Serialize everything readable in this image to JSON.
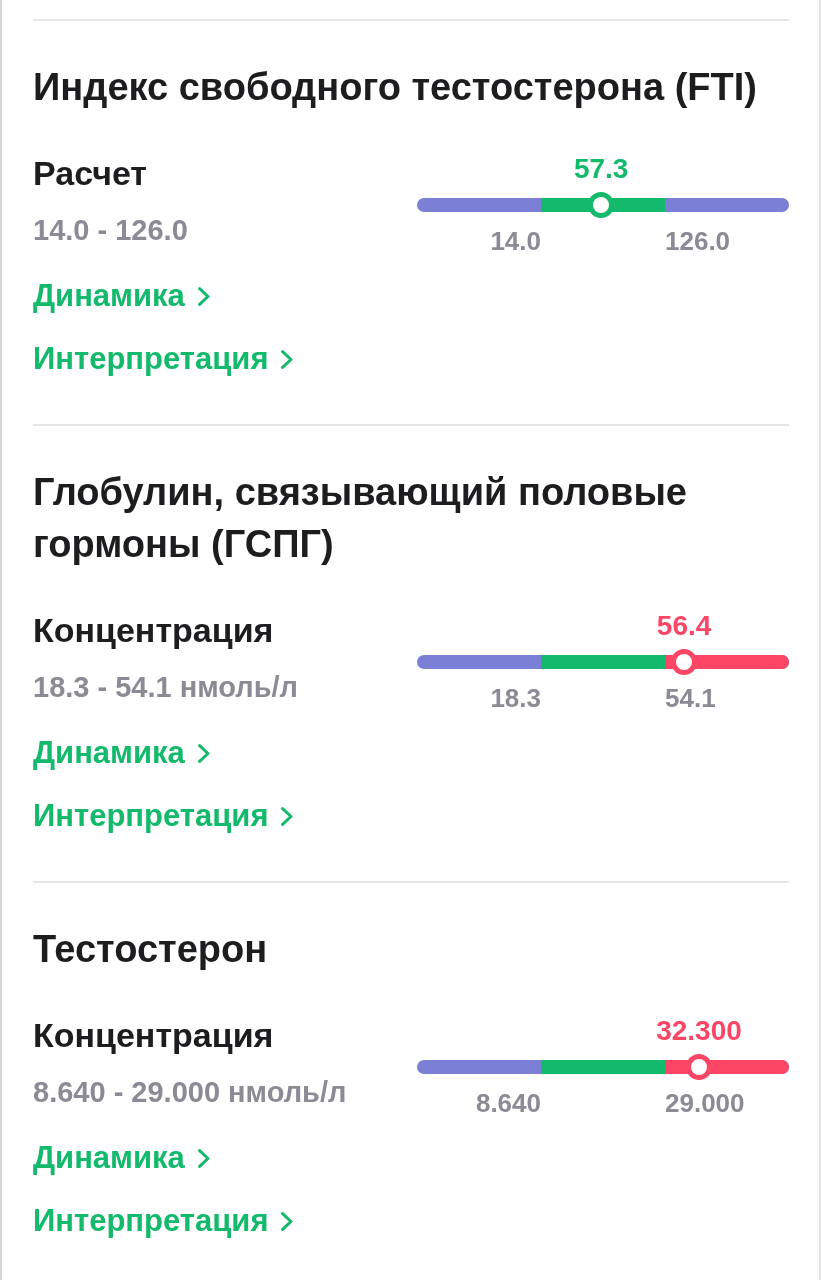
{
  "sections": [
    {
      "title": "Индекс свободного тестостерона (FTI)",
      "measures": [
        {
          "name": "Расчет",
          "range": "14.0 - 126.0",
          "value": "57.3",
          "above_range": false,
          "level": 0.495,
          "min": "14.0",
          "max": "126.0",
          "links": [
            "Динамика",
            "Интерпретация"
          ]
        }
      ]
    },
    {
      "title": "Глобулин, связывающий половые гормоны (ГСПГ)",
      "measures": [
        {
          "name": "Концентрация",
          "range": "18.3 - 54.1 нмоль/л",
          "value": "56.4",
          "above_range": true,
          "level": 0.718,
          "min": "18.3",
          "max": "54.1",
          "links": [
            "Динамика",
            "Интерпретация"
          ]
        }
      ]
    },
    {
      "title": "Тестостерон",
      "measures": [
        {
          "name": "Концентрация",
          "range": "8.640 - 29.000 нмоль/л",
          "value": "32.300",
          "above_range": true,
          "level": 0.758,
          "min": "8.640",
          "max": "29.000",
          "links": [
            "Динамика",
            "Интерпретация"
          ]
        }
      ]
    }
  ]
}
